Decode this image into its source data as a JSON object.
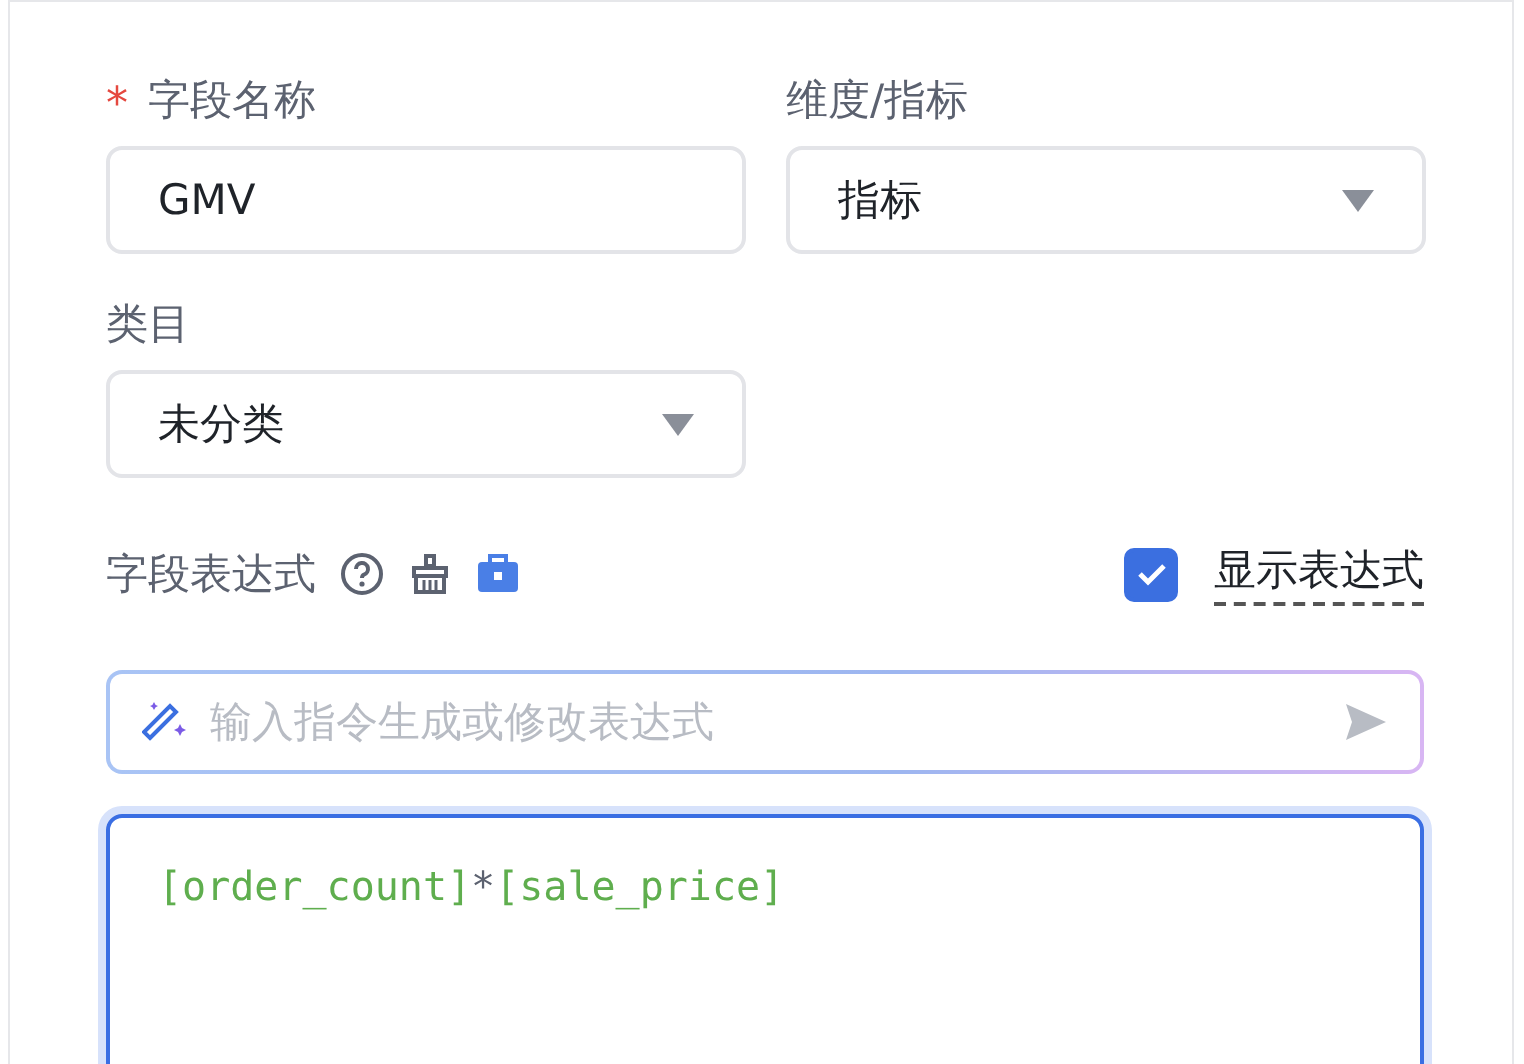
{
  "fields": [
    {
      "label": "字段名称",
      "required": true,
      "kind": "text",
      "value": "GMV"
    },
    {
      "label": "维度/指标",
      "required": false,
      "kind": "select",
      "value": "指标"
    },
    {
      "label": "类目",
      "required": false,
      "kind": "select",
      "value": "未分类"
    }
  ],
  "expression": {
    "label": "字段表达式",
    "show_expression": {
      "label": "显示表达式",
      "checked": true
    },
    "ai_input": {
      "placeholder": "输入指令生成或修改表达式"
    },
    "tokens": [
      {
        "kind": "field",
        "text": "[order_count]"
      },
      {
        "kind": "operator",
        "text": "*"
      },
      {
        "kind": "field",
        "text": "[sale_price]"
      }
    ]
  }
}
